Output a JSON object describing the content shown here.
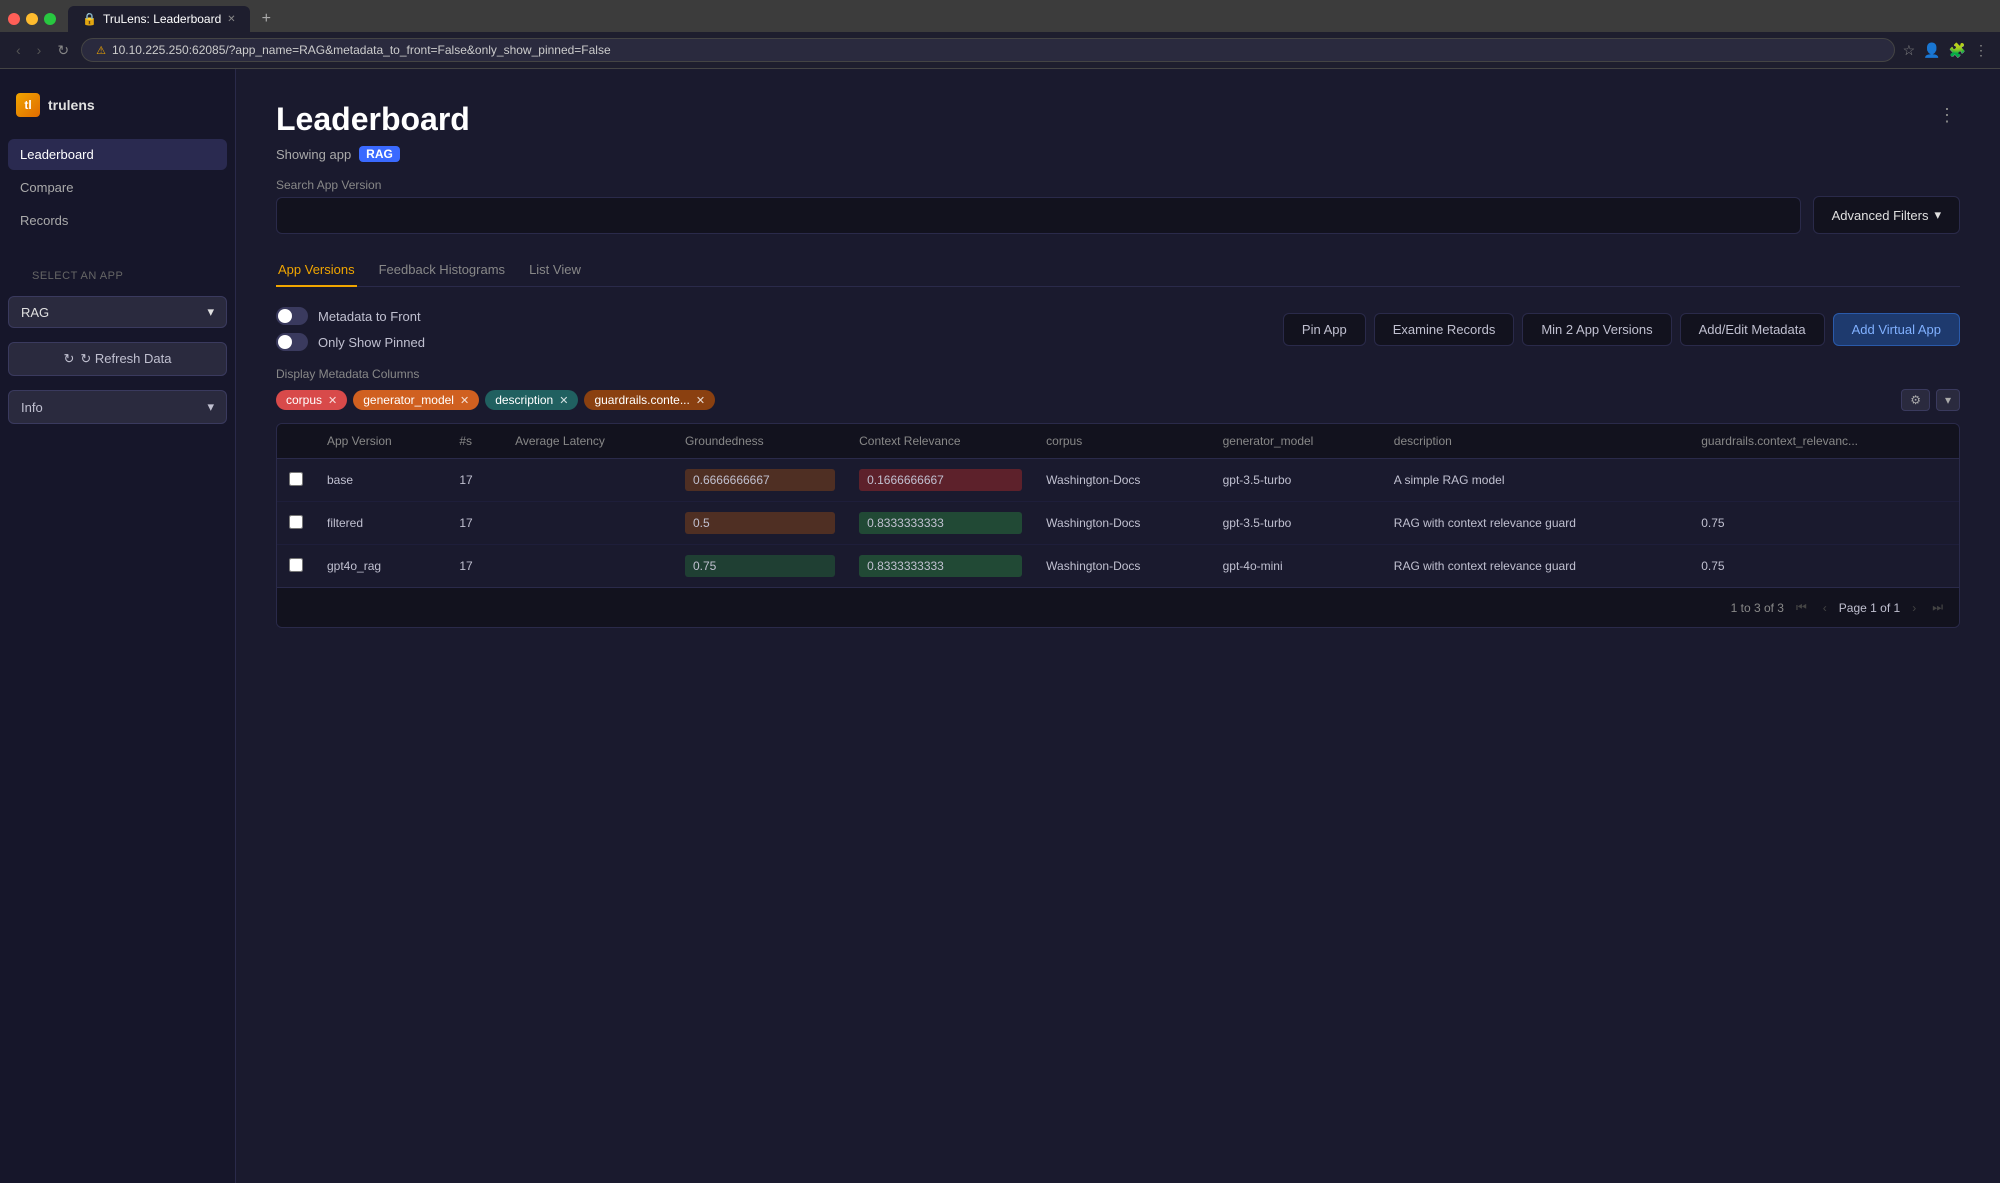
{
  "browser": {
    "tab_title": "TruLens: Leaderboard",
    "url": "10.10.225.250:62085/?app_name=RAG&metadata_to_front=False&only_show_pinned=False",
    "url_warning": "Not Secure"
  },
  "sidebar": {
    "logo_text": "trulens",
    "nav_items": [
      {
        "label": "Leaderboard",
        "active": true
      },
      {
        "label": "Compare",
        "active": false
      },
      {
        "label": "Records",
        "active": false
      }
    ],
    "select_app_label": "Select an app",
    "selected_app": "RAG",
    "refresh_btn": "↻ Refresh Data",
    "info_label": "Info"
  },
  "main": {
    "page_title": "Leaderboard",
    "showing_app_label": "Showing app",
    "app_badge": "RAG",
    "search_label": "Search App Version",
    "search_placeholder": "",
    "advanced_filters_btn": "Advanced Filters",
    "tabs": [
      {
        "label": "App Versions",
        "active": true
      },
      {
        "label": "Feedback Histograms",
        "active": false
      },
      {
        "label": "List View",
        "active": false
      }
    ],
    "toggles": [
      {
        "label": "Metadata to Front",
        "on": false
      },
      {
        "label": "Only Show Pinned",
        "on": false
      }
    ],
    "action_buttons": [
      {
        "label": "Pin App"
      },
      {
        "label": "Examine Records"
      },
      {
        "label": "Min 2 App Versions"
      },
      {
        "label": "Add/Edit Metadata"
      },
      {
        "label": "Add Virtual App"
      }
    ],
    "metadata_columns_label": "Display Metadata Columns",
    "chips": [
      {
        "label": "corpus",
        "color": "red"
      },
      {
        "label": "generator_model",
        "color": "orange"
      },
      {
        "label": "description",
        "color": "teal"
      },
      {
        "label": "guardrails.conte...",
        "color": "dark-orange"
      }
    ],
    "table": {
      "columns": [
        "App Version",
        "#s",
        "Average Latency",
        "Groundedness",
        "Context Relevance",
        "corpus",
        "generator_model",
        "description",
        "guardrails.context_relevanc..."
      ],
      "rows": [
        {
          "checkbox": false,
          "app_version": "base",
          "num": "17",
          "avg_latency": "",
          "groundedness": "0.6666666667",
          "groundedness_type": "med",
          "context_relevance": "0.1666666667",
          "context_type": "low",
          "corpus": "Washington-Docs",
          "generator_model": "gpt-3.5-turbo",
          "description": "A simple RAG model",
          "guardrails": ""
        },
        {
          "checkbox": false,
          "app_version": "filtered",
          "num": "17",
          "avg_latency": "",
          "groundedness": "0.5",
          "groundedness_type": "med",
          "context_relevance": "0.8333333333",
          "context_type": "high",
          "corpus": "Washington-Docs",
          "generator_model": "gpt-3.5-turbo",
          "description": "RAG with context relevance guard",
          "guardrails": "0.75"
        },
        {
          "checkbox": false,
          "app_version": "gpt4o_rag",
          "num": "17",
          "avg_latency": "",
          "groundedness": "0.75",
          "groundedness_type": "high",
          "context_relevance": "0.8333333333",
          "context_type": "high",
          "corpus": "Washington-Docs",
          "generator_model": "gpt-4o-mini",
          "description": "RAG with context relevance guard",
          "guardrails": "0.75"
        }
      ]
    },
    "pagination": {
      "showing": "1 to 3 of 3",
      "page_label": "Page 1 of 1"
    }
  }
}
